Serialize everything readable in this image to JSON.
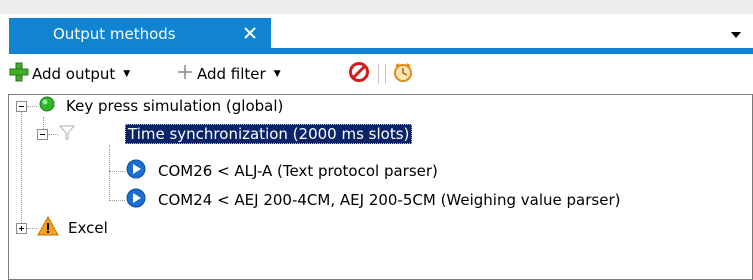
{
  "tab": {
    "title": "Output methods",
    "close_icon": "close-icon",
    "menu_icon": "chevron-down-icon",
    "accent": "#1083d1"
  },
  "toolbar": {
    "add_output_label": "Add output",
    "add_filter_label": "Add filter",
    "icons": [
      "add-plus-icon",
      "filter-icon",
      "remove-icon",
      "scheduler-icon"
    ]
  },
  "tree": {
    "nodes": [
      {
        "label": "Key press simulation (global)",
        "icon": "green-status-icon",
        "expanded": true
      },
      {
        "label": "Time synchronization (2000 ms slots)",
        "icon": "filter-funnel-icon",
        "expanded": true,
        "selected": true
      },
      {
        "label": "COM26 < ALJ-A (Text protocol parser)",
        "icon": "blue-play-icon"
      },
      {
        "label": "COM24 < AEJ 200-4CM, AEJ 200-5CM (Weighing value parser)",
        "icon": "blue-play-icon"
      },
      {
        "label": "Excel",
        "icon": "warning-icon",
        "expanded": false
      }
    ]
  }
}
